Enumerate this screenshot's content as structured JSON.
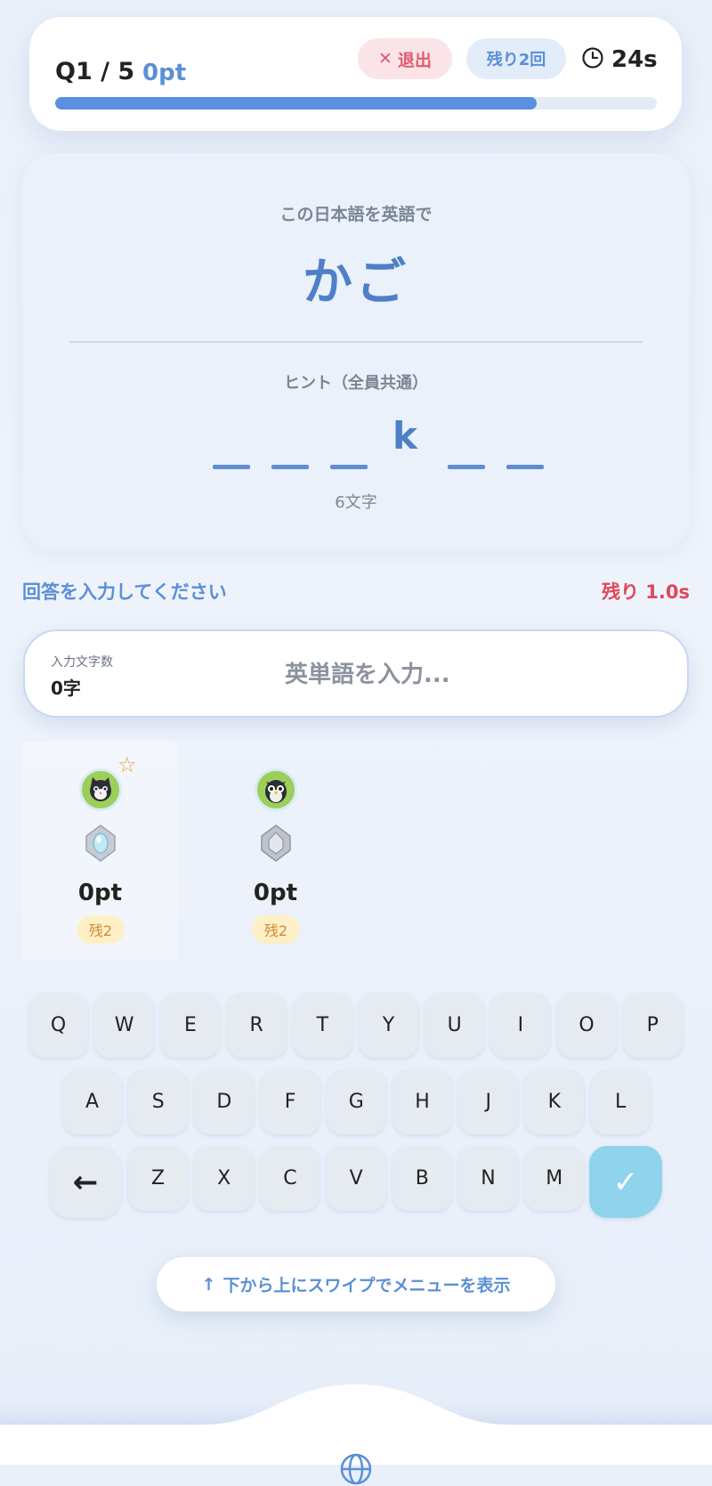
{
  "header": {
    "question": "Q1 / 5",
    "points": "0pt",
    "exit_label": "退出",
    "remaining_label": "残り2回",
    "timer": "24s",
    "progress": 0.8
  },
  "question": {
    "prompt": "この日本語を英語で",
    "word": "かご",
    "hint_label": "ヒント（全員共通）",
    "hint_letters": [
      "",
      "",
      "",
      "k",
      "",
      ""
    ],
    "letter_count": "6文字"
  },
  "answer": {
    "label": "回答を入力してください",
    "remaining_time": "残り 1.0s",
    "char_count_label": "入力文字数",
    "char_count_value": "0字",
    "placeholder": "英単語を入力..."
  },
  "players": [
    {
      "points": "0pt",
      "remaining": "残2",
      "avatar": "cat-icon",
      "leader": true
    },
    {
      "points": "0pt",
      "remaining": "残2",
      "avatar": "owl-icon",
      "leader": false
    }
  ],
  "keyboard": {
    "row1": [
      "Q",
      "W",
      "E",
      "R",
      "T",
      "Y",
      "U",
      "I",
      "O",
      "P"
    ],
    "row2": [
      "A",
      "S",
      "D",
      "F",
      "G",
      "H",
      "J",
      "K",
      "L"
    ],
    "row3": [
      "Z",
      "X",
      "C",
      "V",
      "B",
      "N",
      "M"
    ],
    "back_symbol": "←",
    "ok_symbol": "✓"
  },
  "swipe_hint": "下から上にスワイプでメニューを表示",
  "colors": {
    "accent": "#5b8fd6",
    "danger": "#e0475a",
    "confirm": "#8fd3ec"
  }
}
